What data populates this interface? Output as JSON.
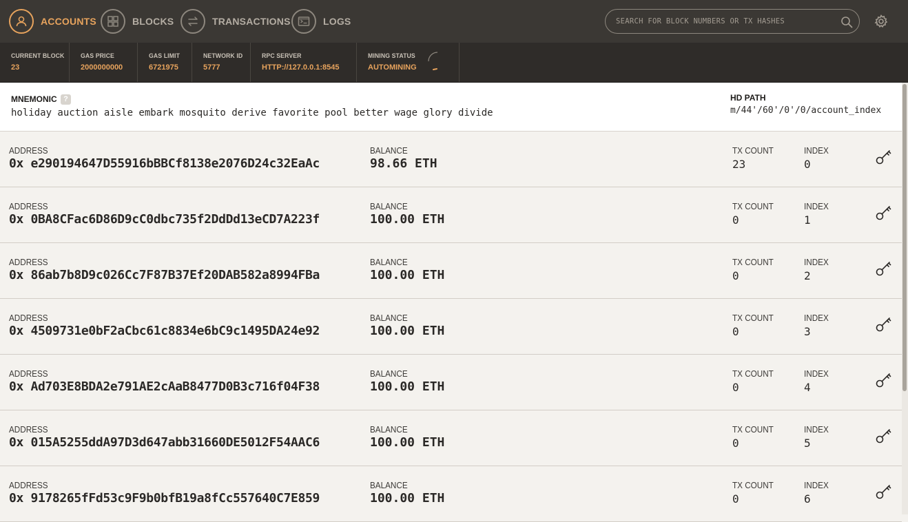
{
  "nav": {
    "accounts": "ACCOUNTS",
    "blocks": "BLOCKS",
    "transactions": "TRANSACTIONS",
    "logs": "LOGS"
  },
  "search": {
    "placeholder": "SEARCH FOR BLOCK NUMBERS OR TX HASHES"
  },
  "status": {
    "current_block_label": "CURRENT BLOCK",
    "current_block": "23",
    "gas_price_label": "GAS PRICE",
    "gas_price": "2000000000",
    "gas_limit_label": "GAS LIMIT",
    "gas_limit": "6721975",
    "network_id_label": "NETWORK ID",
    "network_id": "5777",
    "rpc_label": "RPC SERVER",
    "rpc": "HTTP://127.0.0.1:8545",
    "mining_label": "MINING STATUS",
    "mining": "AUTOMINING"
  },
  "mnemonic": {
    "title": "MNEMONIC",
    "help": "?",
    "words": "holiday auction aisle embark mosquito derive favorite pool better wage glory divide",
    "hd_title": "HD PATH",
    "hd_path": "m/44'/60'/0'/0/account_index"
  },
  "labels": {
    "address": "ADDRESS",
    "balance": "BALANCE",
    "tx_count": "TX COUNT",
    "index": "INDEX"
  },
  "accounts": [
    {
      "address": "0x e290194647D55916bBBCf8138e2076D24c32EaAc",
      "balance": "98.66 ETH",
      "tx_count": "23",
      "index": "0"
    },
    {
      "address": "0x 0BA8CFac6D86D9cC0dbc735f2DdDd13eCD7A223f",
      "balance": "100.00 ETH",
      "tx_count": "0",
      "index": "1"
    },
    {
      "address": "0x 86ab7b8D9c026Cc7F87B37Ef20DAB582a8994FBa",
      "balance": "100.00 ETH",
      "tx_count": "0",
      "index": "2"
    },
    {
      "address": "0x 4509731e0bF2aCbc61c8834e6bC9c1495DA24e92",
      "balance": "100.00 ETH",
      "tx_count": "0",
      "index": "3"
    },
    {
      "address": "0x Ad703E8BDA2e791AE2cAaB8477D0B3c716f04F38",
      "balance": "100.00 ETH",
      "tx_count": "0",
      "index": "4"
    },
    {
      "address": "0x 015A5255ddA97D3d647abb31660DE5012F54AAC6",
      "balance": "100.00 ETH",
      "tx_count": "0",
      "index": "5"
    },
    {
      "address": "0x 9178265fFd53c9F9b0bfB19a8fCc557640C7E859",
      "balance": "100.00 ETH",
      "tx_count": "0",
      "index": "6"
    }
  ],
  "colors": {
    "accent": "#e7a35d",
    "nav_bg": "#3b3834",
    "status_bg": "#2f2c29",
    "page_bg": "#f4f2ee"
  }
}
